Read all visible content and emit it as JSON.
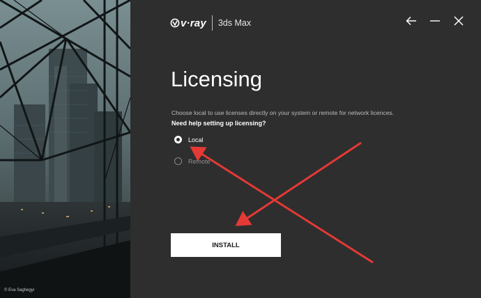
{
  "hero": {
    "credit": "© Eva Saghegyi"
  },
  "logo": {
    "brand": "v·ray",
    "product": "3ds Max"
  },
  "titlebar": {
    "back_icon": "arrow-left-icon",
    "minimize_icon": "minimize-icon",
    "close_icon": "close-icon"
  },
  "page": {
    "title": "Licensing",
    "description": "Choose local to use licenses directly on your system or remote for network licences.",
    "help_link": "Need help setting up licensing?"
  },
  "license_options": [
    {
      "label": "Local",
      "selected": true
    },
    {
      "label": "Remote",
      "selected": false
    }
  ],
  "install_label": "INSTALL",
  "annotation": {
    "color": "#e53935"
  }
}
